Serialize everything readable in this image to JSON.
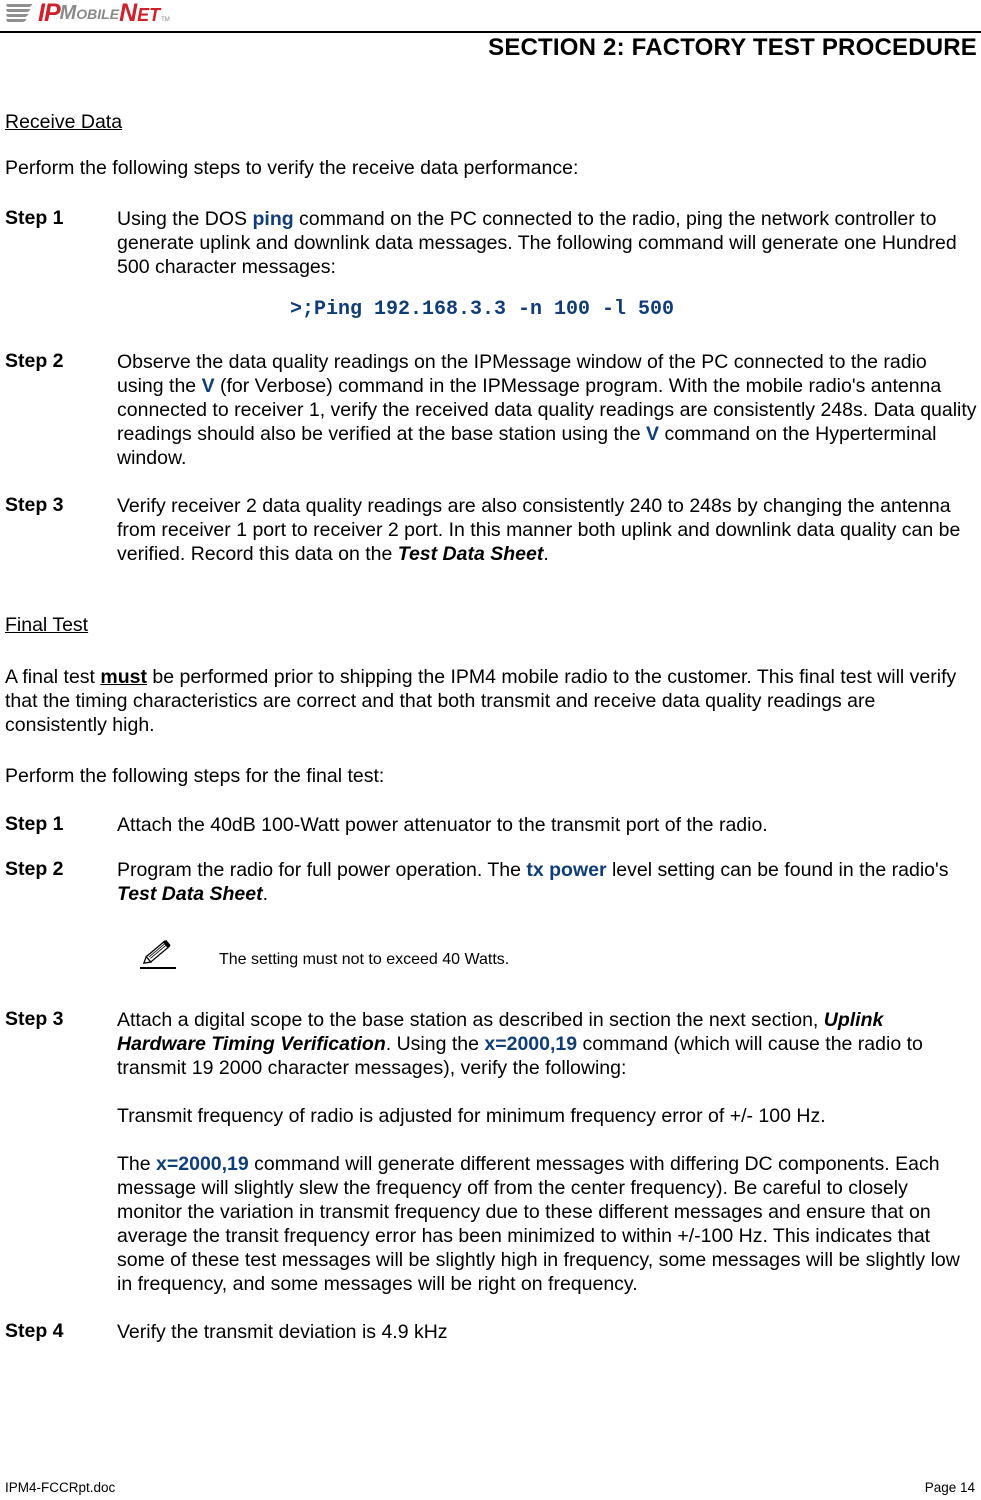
{
  "header": {
    "logo": {
      "ip": "IP",
      "mobile": "Mobile",
      "net": "Net",
      "tm": "TM"
    },
    "section_title": "SECTION 2:  FACTORY TEST PROCEDURE"
  },
  "receive_data": {
    "heading": "Receive Data",
    "intro": "Perform the following steps to verify the receive data performance:",
    "steps": [
      {
        "label": "Step 1",
        "parts": [
          "Using the DOS ",
          "ping",
          " command on the PC connected to the radio, ping the network controller to generate uplink and downlink data messages.  The following command will generate one Hundred 500 character messages:"
        ]
      },
      {
        "label": "Step 2",
        "parts": [
          "Observe the data quality readings on the IPMessage window of the PC connected to the radio using the ",
          "V",
          " (for Verbose) command in the IPMessage program.  With the mobile radio's antenna connected to receiver 1, verify the received data quality readings are consistently 248s.  Data quality readings should also be verified at the base station using the ",
          "V",
          " command on the Hyperterminal window."
        ]
      },
      {
        "label": "Step 3",
        "parts": [
          "Verify receiver 2 data quality readings are also consistently 240 to 248s by changing the antenna from receiver 1 port to receiver 2 port.  In this manner both uplink and downlink data quality can be verified.  Record this data on the ",
          "Test Data Sheet",
          "."
        ]
      }
    ],
    "command": ">;Ping 192.168.3.3 -n 100 -l 500"
  },
  "final_test": {
    "heading": "Final Test",
    "intro_parts": [
      "A final test ",
      "must",
      " be performed prior to shipping the IPM4 mobile radio to the customer.  This final test will verify that the timing characteristics are correct and that both transmit and receive data quality readings are consistently high."
    ],
    "intro2": "Perform the following steps for the final test:",
    "steps": [
      {
        "label": "Step 1",
        "parts": [
          "Attach the 40dB 100-Watt power attenuator to the transmit port of the radio."
        ]
      },
      {
        "label": "Step 2",
        "parts": [
          "Program the radio for full power operation.  The ",
          "tx power",
          " level setting can be found in the radio's ",
          "Test Data Sheet",
          "."
        ]
      },
      {
        "label": "Step 3",
        "parts": [
          "Attach a digital scope to the base station as described in section the next section, ",
          "Uplink Hardware Timing Verification",
          ".  Using the ",
          "x=2000,19",
          " command (which will cause the radio to transmit 19 2000 character messages), verify the following:"
        ]
      },
      {
        "label": "Step 4",
        "parts": [
          "Verify the transmit deviation is 4.9 kHz"
        ]
      }
    ],
    "note": {
      "icon": "pencil-note-icon",
      "text": "The setting must not to exceed 40 Watts."
    },
    "step3_para1": "Transmit frequency of radio is adjusted for minimum frequency error of +/- 100 Hz.",
    "step3_para2_parts": [
      "The ",
      "x=2000,19",
      " command will generate different messages with differing DC components. Each message will slightly slew the frequency off from the center frequency). Be careful to closely monitor the variation in transmit frequency due to these different messages and ensure that on average the transit frequency error has been minimized to within +/-100 Hz. This indicates that some of these test messages will be slightly high in frequency, some messages will be slightly low in frequency, and some messages will be right on frequency."
    ]
  },
  "footer": {
    "filename": "IPM4-FCCRpt.doc",
    "page": "Page 14"
  },
  "colors": {
    "keyword": "#0f3d7a",
    "logo_red": "#d0202a",
    "logo_gray": "#8a8a8a"
  }
}
